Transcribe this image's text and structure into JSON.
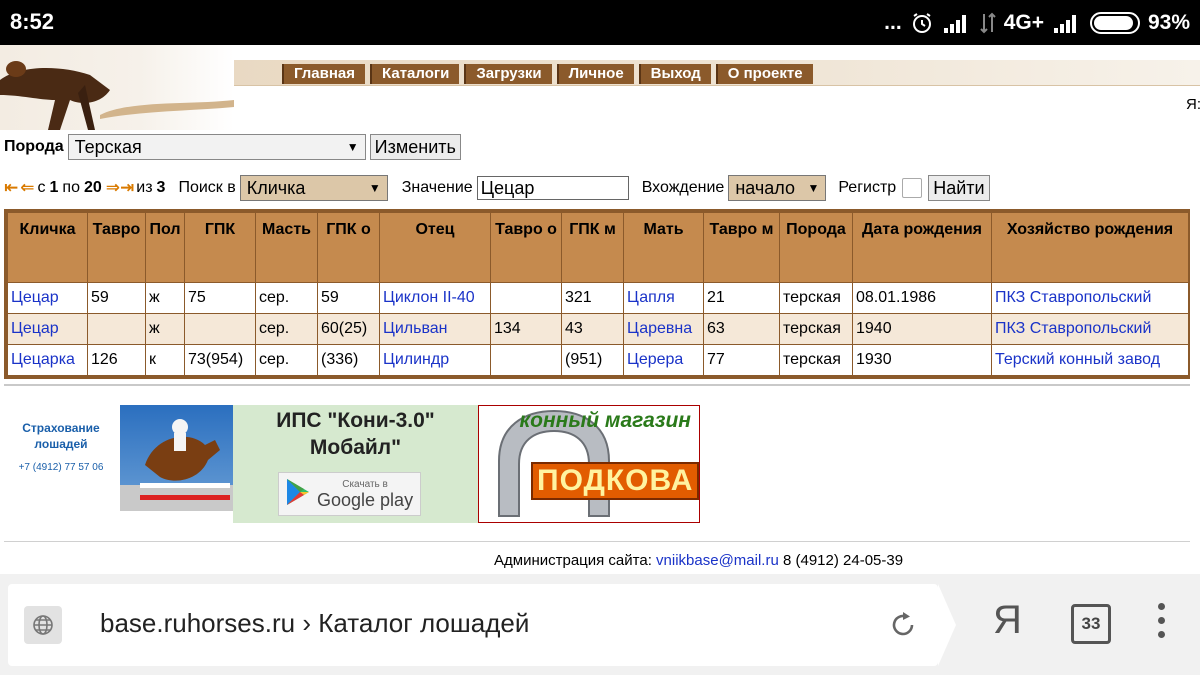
{
  "statusbar": {
    "time": "8:52",
    "dots": "...",
    "network": "4G+",
    "battery_pct": "93%",
    "battery_level": 0.93
  },
  "nav": {
    "items": [
      "Главная",
      "Каталоги",
      "Загрузки",
      "Личное",
      "Выход",
      "О проекте"
    ]
  },
  "header": {
    "ya": "Я:"
  },
  "breed": {
    "label": "Порода",
    "value": "Терская",
    "change_button": "Изменить"
  },
  "search": {
    "from_label": "с",
    "from": "1",
    "to_label": "по",
    "to": "20",
    "of_label": "из",
    "of": "3",
    "search_in_label": "Поиск в",
    "search_in_value": "Кличка",
    "value_label": "Значение",
    "value": "Цецар",
    "occurrence_label": "Вхождение",
    "occurrence_value": "начало",
    "register_label": "Регистр",
    "find_button": "Найти"
  },
  "table": {
    "headers": [
      "Кличка",
      "Тавро",
      "Пол",
      "ГПК",
      "Масть",
      "ГПК о",
      "Отец",
      "Тавро о",
      "ГПК м",
      "Мать",
      "Тавро м",
      "Порода",
      "Дата рождения",
      "Хозяйство рождения"
    ],
    "rows": [
      [
        "Цецар",
        "59",
        "ж",
        "75",
        "сер.",
        "59",
        "Циклон II-40",
        "",
        "321",
        "Цапля",
        "21",
        "терская",
        "08.01.1986",
        "ПКЗ Ставропольский"
      ],
      [
        "Цецар",
        "",
        "ж",
        "",
        "сер.",
        "60(25)",
        "Цильван",
        "134",
        "43",
        "Царевна",
        "63",
        "терская",
        "1940",
        "ПКЗ Ставропольский"
      ],
      [
        "Цецарка",
        "126",
        "к",
        "73(954)",
        "сер.",
        "(336)",
        "Цилиндр",
        "",
        "(951)",
        "Церера",
        "77",
        "терская",
        "1930",
        "Терский конный завод"
      ]
    ]
  },
  "banners": {
    "insurance_title": "Страхование лошадей",
    "insurance_phone": "+7 (4912) 77 57 06",
    "app_title": "ИПС \"Кони-3.0\" Мобайл\"",
    "gplay_small": "Скачать в",
    "gplay_big": "Google play",
    "shop_title": "конный магазин",
    "shop_name": "ПОДКОВА"
  },
  "footer": {
    "label": "Администрация сайта:",
    "email": "vniikbase@mail.ru",
    "phone": "8 (4912) 24-05-39"
  },
  "browser": {
    "url": "base.ruhorses.ru › Каталог лошадей",
    "ya": "Я",
    "tabs_count": "33"
  }
}
